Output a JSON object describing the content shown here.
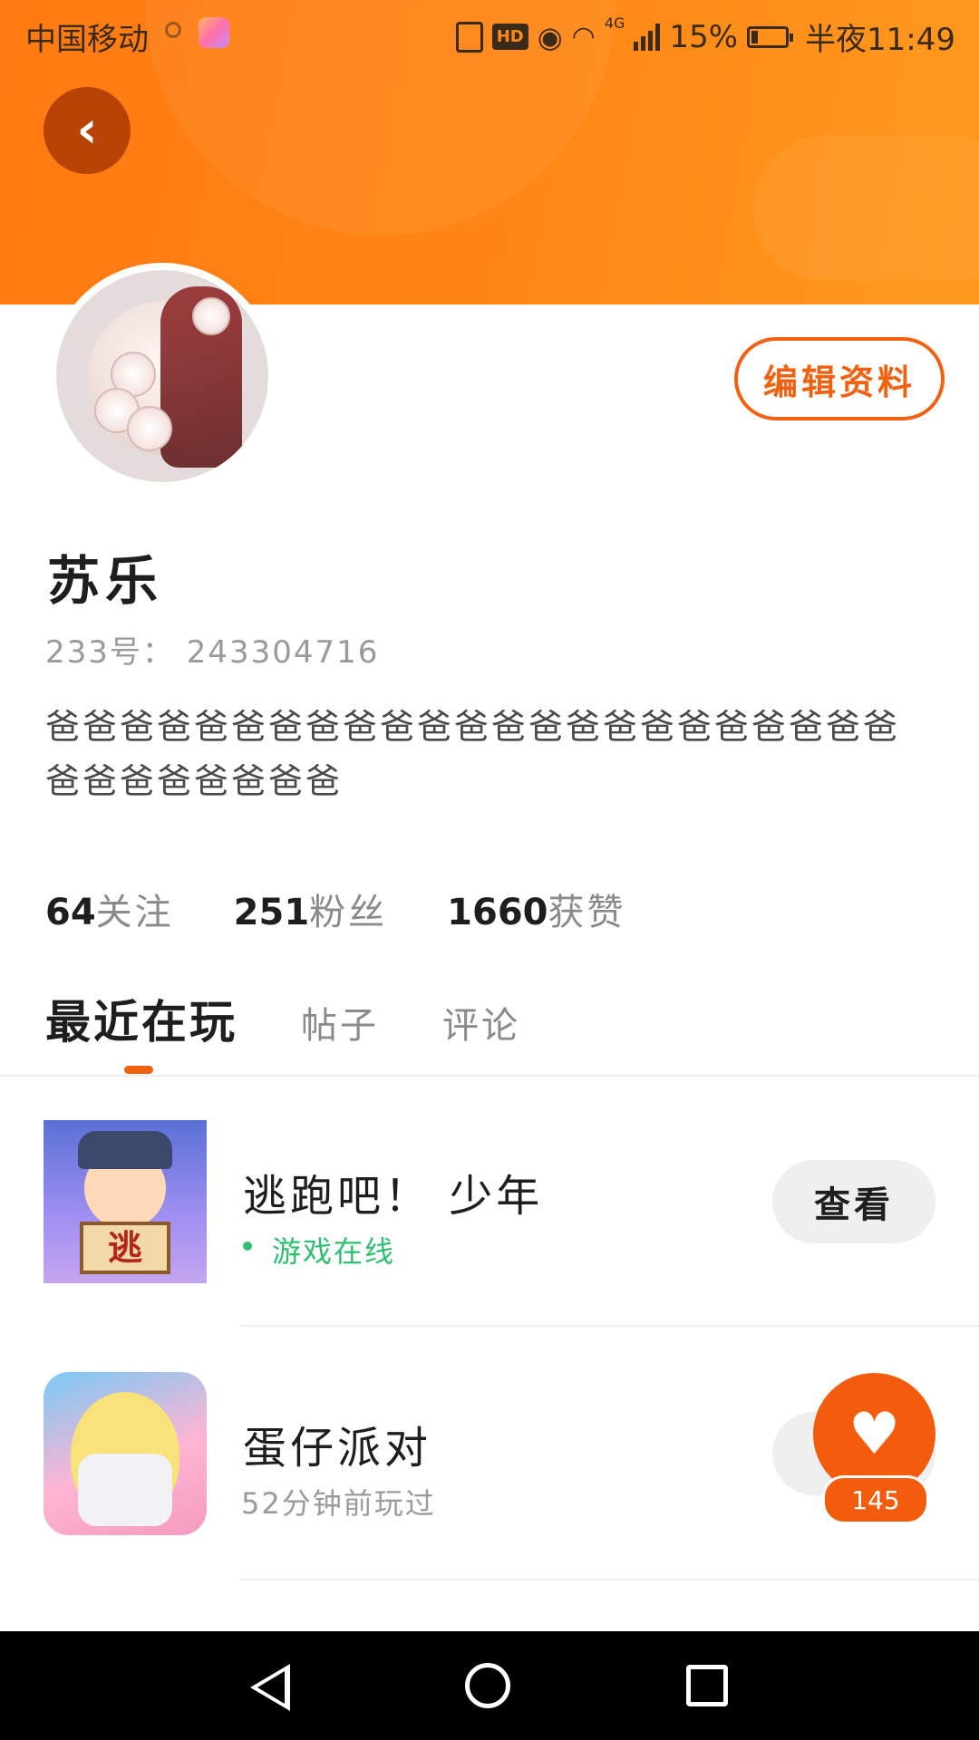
{
  "status_bar": {
    "carrier": "中国移动",
    "hd_badge": "HD",
    "network": "4G",
    "battery": "15%",
    "time": "半夜11:49"
  },
  "header": {
    "back_icon": "chevron-left-icon",
    "accent_color": "#ff7a12"
  },
  "profile": {
    "edit_label": "编辑资料",
    "name": "苏乐",
    "uid_text": "233号： 243304716",
    "bio": "爸爸爸爸爸爸爸爸爸爸爸爸爸爸爸爸爸爸爸爸爸爸爸爸爸爸爸爸爸爸爸"
  },
  "stats": [
    {
      "num": "64",
      "label": "关注"
    },
    {
      "num": "251",
      "label": "粉丝"
    },
    {
      "num": "1660",
      "label": "获赞"
    }
  ],
  "tabs": [
    {
      "label": "最近在玩",
      "active": true
    },
    {
      "label": "帖子",
      "active": false
    },
    {
      "label": "评论",
      "active": false
    }
  ],
  "games": [
    {
      "title": "逃跑吧！ 少年",
      "status": "游戏在线",
      "thumb_text": "逃",
      "button": "查看"
    },
    {
      "title": "蛋仔派对",
      "status": "52分钟前玩过"
    }
  ],
  "like_fab": {
    "count": "145",
    "icon": "heart-icon"
  },
  "nav_bar": {
    "back": "nav-back-icon",
    "home": "nav-home-icon",
    "recent": "nav-recent-icon"
  }
}
